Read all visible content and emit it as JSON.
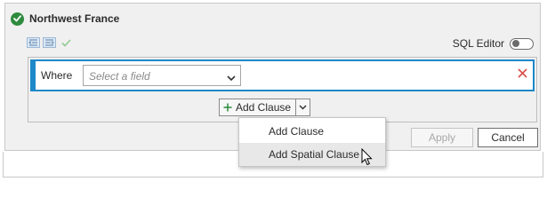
{
  "header": {
    "title": "Northwest France",
    "status_icon": "check-circle-icon",
    "status_color": "#2e8b3e"
  },
  "toolbar": {
    "buttons": [
      "indent-left-icon",
      "indent-right-icon",
      "checkmark-icon"
    ]
  },
  "sql_editor": {
    "label": "SQL Editor",
    "enabled": false
  },
  "clause": {
    "where_label": "Where",
    "field_placeholder": "Select a field",
    "remove_icon": "close-icon",
    "remove_color": "#d9534f"
  },
  "add_clause": {
    "plus_icon": "plus-icon",
    "label": "Add Clause",
    "dropdown_icon": "chevron-down-icon"
  },
  "menu": {
    "items": [
      {
        "label": "Add Clause",
        "hovered": false
      },
      {
        "label": "Add Spatial Clause",
        "hovered": true
      }
    ]
  },
  "buttons": {
    "apply": "Apply",
    "cancel": "Cancel"
  },
  "accent_color": "#1e88c9"
}
